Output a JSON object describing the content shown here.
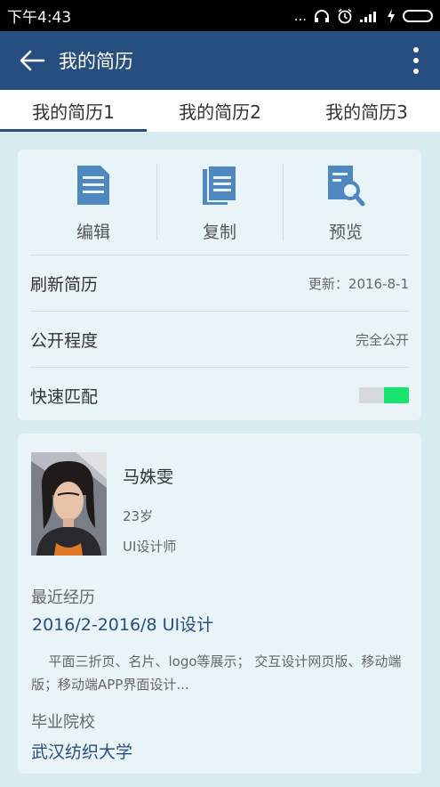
{
  "status_bar": {
    "time": "下午4:43",
    "signal_dots": "...",
    "icons": [
      "headset-icon",
      "alarm-icon",
      "signal-icon",
      "charging-icon",
      "battery-icon"
    ],
    "signal_text": ".ııl"
  },
  "app_bar": {
    "title": "我的简历",
    "back_icon": "back-arrow-icon",
    "more_icon": "more-vertical-icon"
  },
  "tabs": [
    {
      "label": "我的简历1",
      "active": true
    },
    {
      "label": "我的简历2",
      "active": false
    },
    {
      "label": "我的简历3",
      "active": false
    }
  ],
  "actions": [
    {
      "label": "编辑",
      "icon": "document-edit-icon"
    },
    {
      "label": "复制",
      "icon": "copy-icon"
    },
    {
      "label": "预览",
      "icon": "preview-search-icon"
    }
  ],
  "settings": {
    "refresh": {
      "label": "刷新简历",
      "value": "更新：2016-8-1"
    },
    "visibility": {
      "label": "公开程度",
      "value": "完全公开"
    },
    "quick_match": {
      "label": "快速匹配",
      "enabled": true
    }
  },
  "profile": {
    "name": "马姝雯",
    "age": "23岁",
    "job": "UI设计师",
    "recent_title": "最近经历",
    "recent_period": "2016/2-2016/8",
    "recent_role": "UI设计",
    "recent_desc": "平面三折页、名片、logo等展示； 交互设计网页版、移动端版；移动端APP界面设计...",
    "school_title": "毕业院校",
    "school": "武汉纺织大学"
  },
  "colors": {
    "primary": "#264e7e",
    "background": "#d7ebf0",
    "card": "#e8f4f7",
    "toggle_on": "#17e36f",
    "icon_blue": "#4f87c0"
  }
}
